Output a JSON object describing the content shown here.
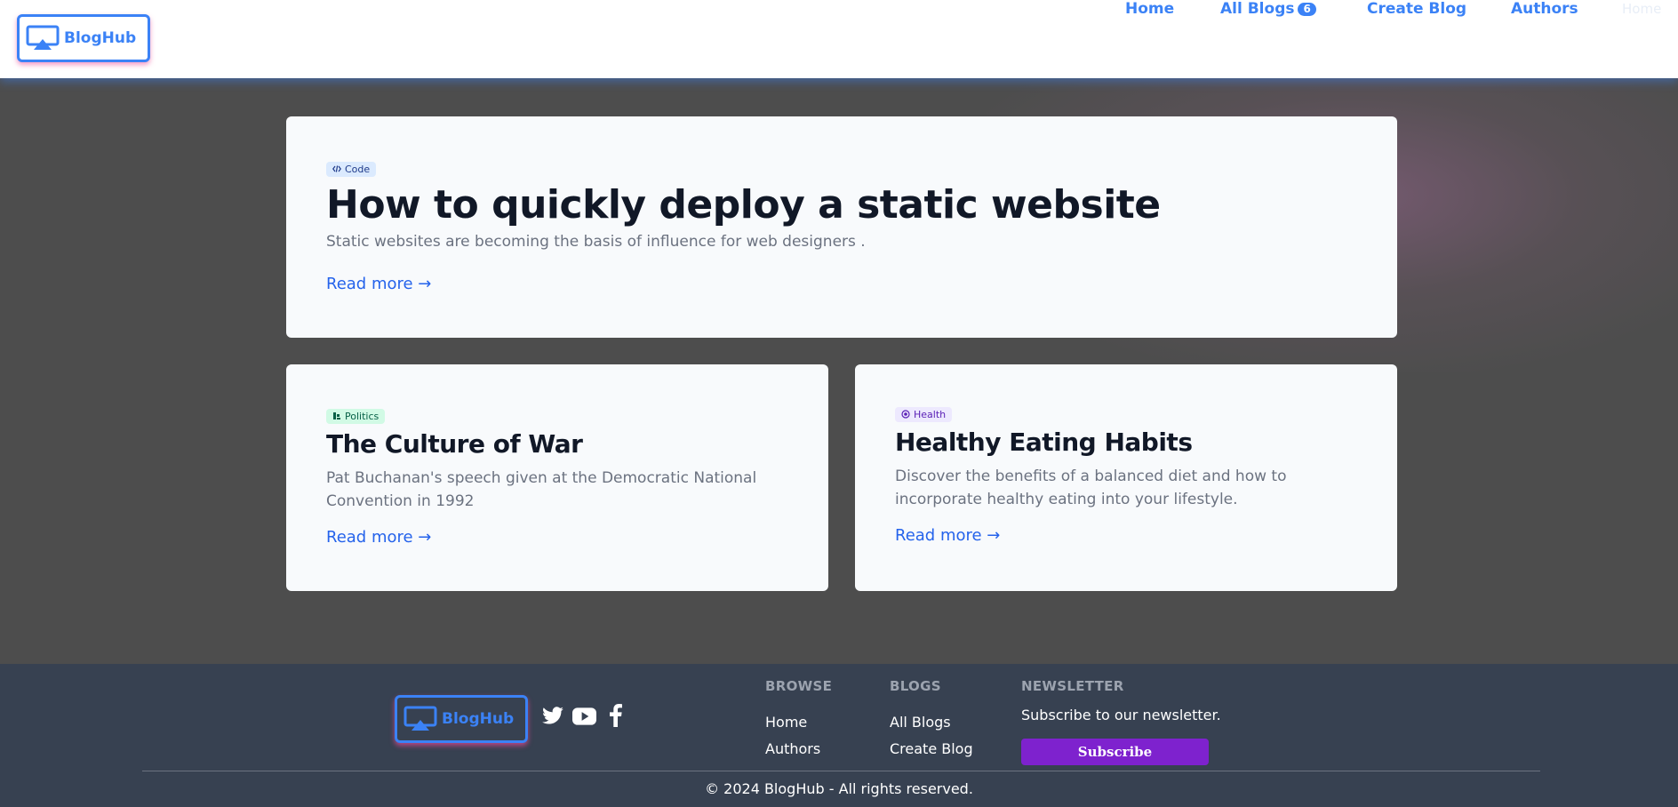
{
  "header": {
    "logo_text": "BlogHub",
    "nav": {
      "home": "Home",
      "all_blogs": "All Blogs",
      "all_blogs_count": "6",
      "create_blog": "Create Blog",
      "authors": "Authors",
      "ghost_home": "Home"
    }
  },
  "featured": {
    "tag": "Code",
    "title": "How to quickly deploy a static website",
    "description": "Static websites are becoming the basis of influence for web designers .",
    "read_more": "Read more →"
  },
  "posts": [
    {
      "tag": "Politics",
      "title": "The Culture of War",
      "description": "Pat Buchanan's speech given at the Democratic National Convention in 1992",
      "read_more": "Read more →"
    },
    {
      "tag": "Health",
      "title": "Healthy Eating Habits",
      "description": "Discover the benefits of a balanced diet and how to incorporate healthy eating into your lifestyle.",
      "read_more": "Read more →"
    }
  ],
  "footer": {
    "logo_text": "BlogHub",
    "social_icons": [
      "twitter-icon",
      "youtube-icon",
      "facebook-icon"
    ],
    "browse": {
      "heading": "BROWSE",
      "links": [
        "Home",
        "Authors"
      ]
    },
    "blogs": {
      "heading": "BLOGS",
      "links": [
        "All Blogs",
        "Create Blog"
      ]
    },
    "newsletter": {
      "heading": "NEWSLETTER",
      "text": "Subscribe to our newsletter.",
      "button": "Subscribe"
    },
    "copyright": "© 2024 BlogHub - All rights reserved."
  },
  "colors": {
    "accent": "#3b82f6",
    "subscribe": "#7e22ce",
    "footer_bg": "#374151",
    "page_bg": "#4d4d4d"
  }
}
